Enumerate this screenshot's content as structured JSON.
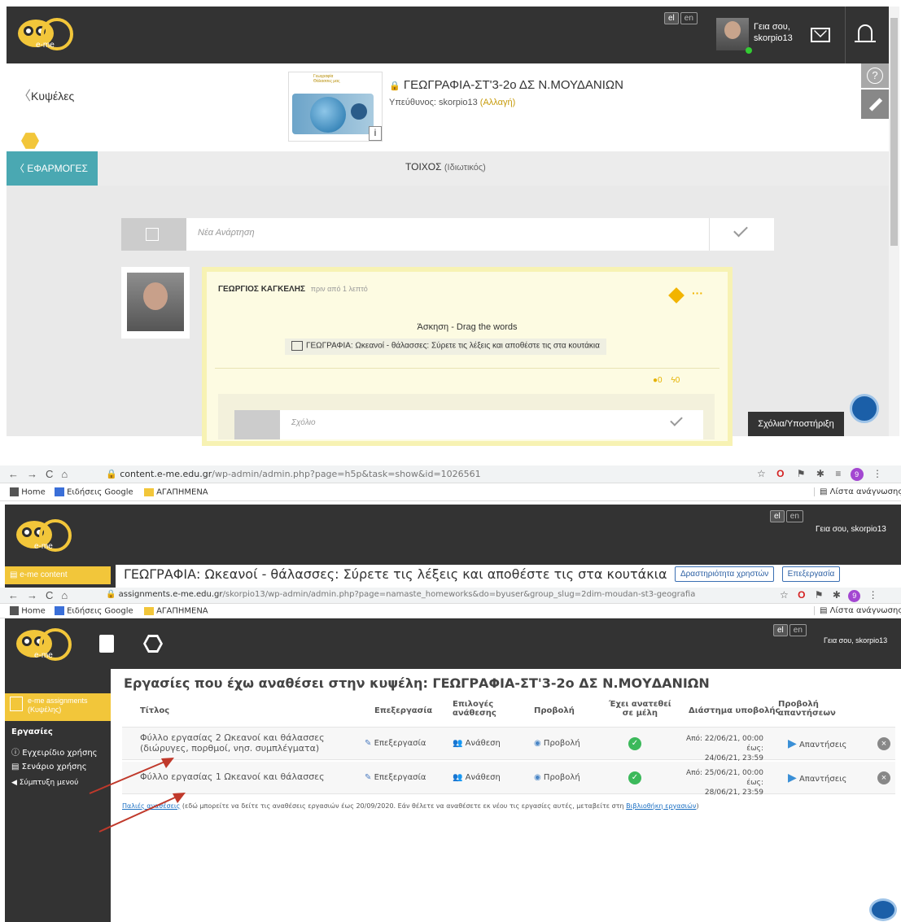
{
  "top": {
    "lang": [
      "el",
      "en"
    ],
    "greeting_line1": "Γεια σου,",
    "greeting_line2": "skorpio13",
    "back_label": "Κυψέλες",
    "course_title": "ΓΕΩΓΡΑΦΙΑ-ΣΤ'3-2ο ΔΣ Ν.ΜΟΥΔΑΝΙΩΝ",
    "responsible_label": "Υπεύθυνος: skorpio13",
    "change_link": "(Αλλαγή)",
    "thumb_caption_1": "Γεωγραφία",
    "thumb_caption_2": "Θάλασσες μας",
    "apps_label": "ΕΦΑΡΜΟΓΕΣ",
    "wall_title": "ΤΟΙΧΟΣ",
    "wall_sub": "(Ιδιωτικός)",
    "new_post_placeholder": "Νέα Ανάρτηση",
    "post_author": "ΓΕΩΡΓΙΟΣ ΚΑΓΚΕΛΗΣ",
    "post_time": "πριν από 1 λεπτό",
    "post_heading": "Άσκηση - Drag the words",
    "post_link": "ΓΕΩΓΡΑΦΙΑ: Ωκεανοί - θάλασσες: Σύρετε τις λέξεις και αποθέστε τις στα κουτάκια",
    "comments_count": "0",
    "likes_count": "0",
    "comment_placeholder": "Σχόλιο",
    "support_button": "Σχόλια/Υποστήριξη",
    "more_icon": "···"
  },
  "browser1": {
    "url_host": "content.e-me.edu.gr",
    "url_path": "/wp-admin/admin.php?page=h5p&task=show&id=1026561",
    "bookmarks": [
      "Home",
      "Ειδήσεις Google",
      "ΑΓΑΠΗΜΕΝΑ"
    ],
    "reading_list": "Λίστα ανάγνωσης",
    "badge": "9"
  },
  "content": {
    "lang": [
      "el",
      "en"
    ],
    "greeting": "Γεια σου, skorpio13",
    "side_label": "e-me content",
    "title": "ΓΕΩΓΡΑΦΙΑ: Ωκεανοί - θάλασσες: Σύρετε τις λέξεις και αποθέστε τις στα κουτάκια",
    "btn_activity": "Δραστηριότητα χρηστών",
    "btn_edit": "Επεξεργασία"
  },
  "browser2": {
    "url_host": "assignments.e-me.edu.gr",
    "url_path": "/skorpio13/wp-admin/admin.php?page=namaste_homeworks&do=byuser&group_slug=2dim-moudan-st3-geografia",
    "bookmarks": [
      "Home",
      "Ειδήσεις Google",
      "ΑΓΑΠΗΜΕΝΑ"
    ],
    "reading_list": "Λίστα ανάγνωσης",
    "badge": "9"
  },
  "assign": {
    "lang": [
      "el",
      "en"
    ],
    "greeting": "Γεια σου, skorpio13",
    "side_label_1": "e-me assignments",
    "side_label_2": "(Κυψέλης)",
    "side_section": "Εργασίες",
    "side_items": [
      "Εγχειρίδιο χρήσης",
      "Σενάριο χρήσης",
      "Σύμπτυξη μενού"
    ],
    "title": "Εργασίες που έχω αναθέσει στην κυψέλη: ΓΕΩΓΡΑΦΙΑ-ΣΤ'3-2ο ΔΣ Ν.ΜΟΥΔΑΝΙΩΝ",
    "headers": {
      "title": "Τίτλος",
      "edit": "Επεξεργασία",
      "assign_opts_1": "Επιλογές",
      "assign_opts_2": "ανάθεσης",
      "view": "Προβολή",
      "assigned_1": "Έχει ανατεθεί",
      "assigned_2": "σε μέλη",
      "period": "Διάστημα υποβολής",
      "answers_1": "Προβολή",
      "answers_2": "απαντήσεων"
    },
    "rows": [
      {
        "title_1": "Φύλλο εργασίας 2 Ωκεανοί και θάλασσες",
        "title_2": "(διώρυγες, πορθμοί, νησ. συμπλέγματα)",
        "edit": "Επεξεργασία",
        "assign": "Ανάθεση",
        "view": "Προβολή",
        "period_1": "Από: 22/06/21, 00:00 έως:",
        "period_2": "24/06/21, 23:59",
        "answers": "Απαντήσεις"
      },
      {
        "title_1": "Φύλλο εργασίας 1 Ωκεανοί και θάλασσες",
        "title_2": "",
        "edit": "Επεξεργασία",
        "assign": "Ανάθεση",
        "view": "Προβολή",
        "period_1": "Από: 25/06/21, 00:00 έως:",
        "period_2": "28/06/21, 23:59",
        "answers": "Απαντήσεις"
      }
    ],
    "old_link": "Παλιές αναθέσεις",
    "old_text": " (εδώ μπορείτε να δείτε τις αναθέσεις εργασιών έως 20/09/2020. Εάν θέλετε να αναθέσετε εκ νέου τις εργασίες αυτές, μεταβείτε στη ",
    "library_link": "Βιβλιοθήκη εργασιών",
    "close_paren": ")"
  },
  "colors": {
    "dark": "#333333",
    "yellow": "#f2c63a",
    "teal": "#4aa8b2",
    "blue_link": "#1b6fc2",
    "arrow": "#c0392b"
  }
}
